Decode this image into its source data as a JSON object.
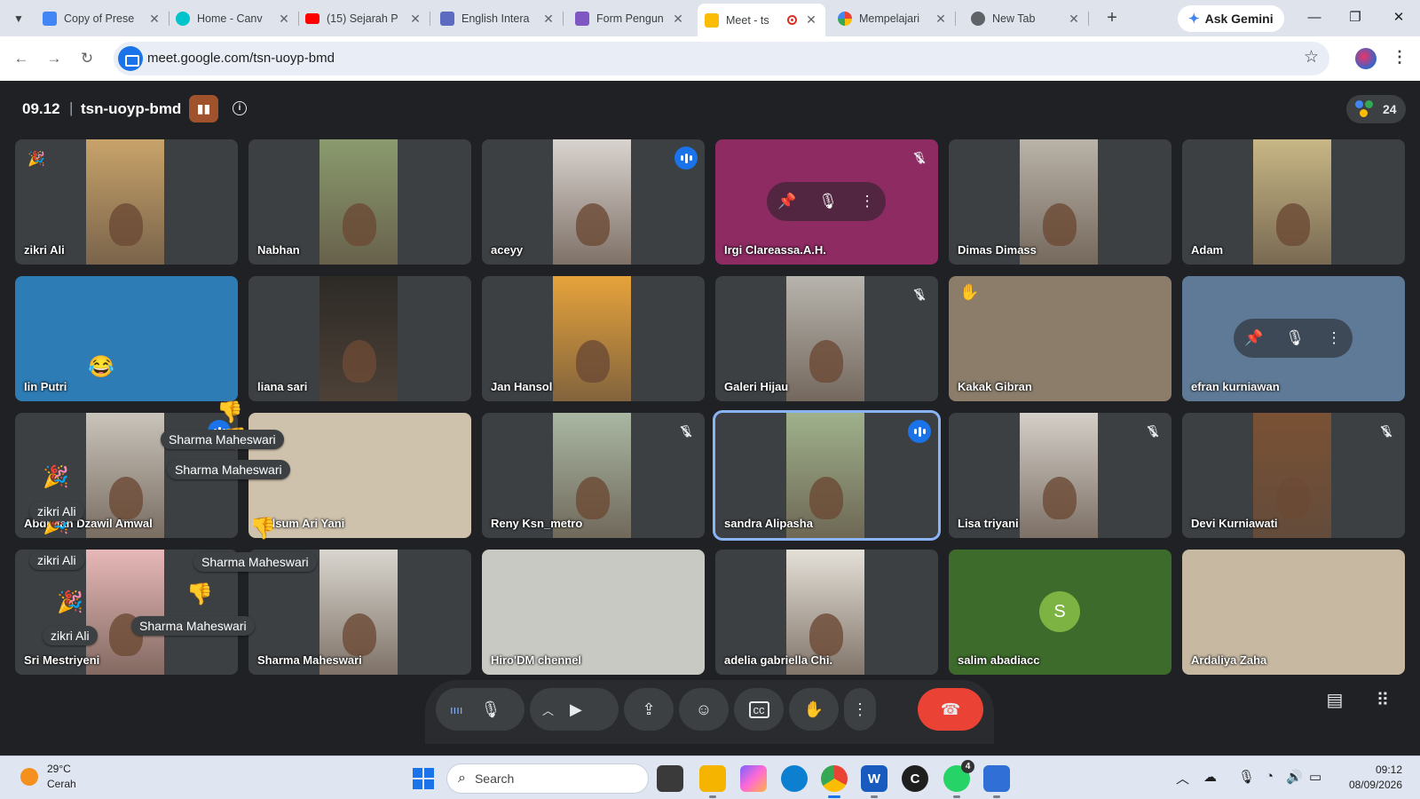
{
  "browser": {
    "tabs": [
      {
        "label": "Copy of Prese",
        "icon": "slides-icon",
        "color": "#4285f4"
      },
      {
        "label": "Home - Canv",
        "icon": "canva-icon",
        "color": "#00c4cc"
      },
      {
        "label": "(15) Sejarah P",
        "icon": "youtube-icon",
        "color": "#ff0000"
      },
      {
        "label": "English Intera",
        "icon": "classroom-icon",
        "color": "#5c6bc0"
      },
      {
        "label": "Form Pengun",
        "icon": "forms-icon",
        "color": "#7e57c2"
      },
      {
        "label": "Meet - ts",
        "icon": "meet-icon",
        "color": "#fbbc04",
        "active": true
      },
      {
        "label": "Mempelajari",
        "icon": "google-icon",
        "color": "#ffffff"
      },
      {
        "label": "New Tab",
        "icon": "chrome-icon",
        "color": "#5f6368"
      }
    ],
    "ask_gemini": "Ask Gemini",
    "url": "meet.google.com/tsn-uoyp-bmd"
  },
  "meet": {
    "time": "09.12",
    "meeting_code": "tsn-uoyp-bmd",
    "participant_count": "24",
    "participants": [
      {
        "name": "zikri Ali",
        "bg": "#3c4043",
        "video": "#c8a36a",
        "state": "none"
      },
      {
        "name": "Nabhan",
        "bg": "#3c4043",
        "video": "#8a9b6e",
        "state": "none"
      },
      {
        "name": "aceyy",
        "bg": "#3c4043",
        "video": "#d9d3cf",
        "state": "talking"
      },
      {
        "name": "Irgi Clareassa.A.H.",
        "bg": "#8e2b63",
        "video": "",
        "state": "muted"
      },
      {
        "name": "Dimas Dimass",
        "bg": "#3c4043",
        "video": "#b9b3a8",
        "state": "none"
      },
      {
        "name": "Adam",
        "bg": "#3c4043",
        "video": "#c7b785",
        "state": "none"
      },
      {
        "name": "Iin Putri",
        "bg": "#2d7cb5",
        "video": "",
        "state": "none"
      },
      {
        "name": "liana sari",
        "bg": "#3c4043",
        "video": "#2d2a26",
        "state": "none"
      },
      {
        "name": "Jan Hansol",
        "bg": "#3c4043",
        "video": "#e6a33b",
        "state": "none"
      },
      {
        "name": "Galeri Hijau",
        "bg": "#3c4043",
        "video": "#b7b4ad",
        "state": "muted"
      },
      {
        "name": "Kakak Gibran",
        "bg": "#8b7d6a",
        "video": "",
        "state": "hand"
      },
      {
        "name": "efran kurniawan",
        "bg": "#5f7a96",
        "video": "",
        "state": "none"
      },
      {
        "name": "Abdullah Dzawil Amwal",
        "bg": "#3c4043",
        "video": "#c9c4bb",
        "state": "talking"
      },
      {
        "name": "Kalsum Ari Yani",
        "bg": "#cfc2ad",
        "video": "",
        "state": "none"
      },
      {
        "name": "Reny Ksn_metro",
        "bg": "#3c4043",
        "video": "#a9b7a3",
        "state": "muted"
      },
      {
        "name": "sandra Alipasha",
        "bg": "#3c4043",
        "video": "#9fb18c",
        "state": "talking"
      },
      {
        "name": "Lisa triyani",
        "bg": "#3c4043",
        "video": "#d4cfc8",
        "state": "muted"
      },
      {
        "name": "Devi Kurniawati",
        "bg": "#3c4043",
        "video": "#7a5134",
        "state": "muted"
      },
      {
        "name": "Sri Mestriyeni",
        "bg": "#3c4043",
        "video": "#e7b8b8",
        "state": "none"
      },
      {
        "name": "Sharma Maheswari",
        "bg": "#3c4043",
        "video": "#d9d6cf",
        "state": "none"
      },
      {
        "name": "Hiro'DM chennel",
        "bg": "#c9c9c4",
        "video": "",
        "state": "none"
      },
      {
        "name": "adelia gabriella Chi.",
        "bg": "#3c4043",
        "video": "#e4e0d8",
        "state": "none"
      },
      {
        "name": "salim abadiacc",
        "bg": "#3d6b2b",
        "video": "",
        "state": "avatar",
        "initial": "S"
      },
      {
        "name": "Ardaliya Zaha",
        "bg": "#c7b8a2",
        "video": "",
        "state": "none"
      }
    ],
    "reactions": [
      {
        "name": "Sharma Maheswari"
      },
      {
        "name": "Sharma Maheswari"
      },
      {
        "name": "zikri Ali"
      },
      {
        "name": "zikri Ali"
      },
      {
        "name": "Sharma Maheswari"
      },
      {
        "name": "Sharma Maheswari"
      },
      {
        "name": "zikri Ali"
      }
    ]
  },
  "taskbar": {
    "temperature": "29°C",
    "weather": "Cerah",
    "search_placeholder": "Search",
    "whatsapp_badge": "4",
    "time": "09:12",
    "date": "08/09/2026"
  }
}
